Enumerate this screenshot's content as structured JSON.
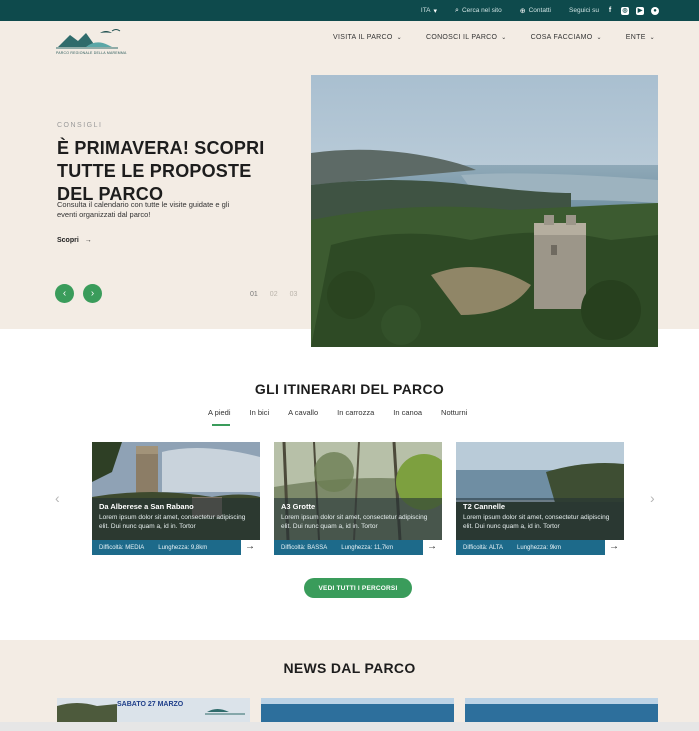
{
  "topbar": {
    "language": "ITA",
    "search": "Cerca nel sito",
    "contacts": "Contatti",
    "follow": "Seguici su",
    "socials": [
      "facebook-icon",
      "instagram-icon",
      "youtube-icon",
      "tripadvisor-icon"
    ]
  },
  "header": {
    "logo_text": "PARCO REGIONALE DELLA MAREMMA",
    "nav": [
      "VISITA IL PARCO",
      "CONOSCI IL PARCO",
      "COSA FACCIAMO",
      "ENTE"
    ]
  },
  "hero": {
    "kicker": "CONSIGLI",
    "title": "È PRIMAVERA! SCOPRI TUTTE LE PROPOSTE DEL PARCO",
    "description": "Consulta il calendario con tutte le visite guidate e gli eventi organizzati dal parco!",
    "cta": "Scopri",
    "dots": [
      "01",
      "02",
      "03"
    ]
  },
  "itinerari": {
    "title": "GLI ITINERARI DEL PARCO",
    "tabs": [
      "A piedi",
      "In bici",
      "A cavallo",
      "In carrozza",
      "In canoa",
      "Notturni"
    ],
    "cards": [
      {
        "title": "Da Alberese a San Rabano",
        "text": "Lorem ipsum dolor sit amet, consectetur adipiscing elit. Dui nunc quam a, id in. Tortor",
        "difficulty": "Difficoltà: MEDIA",
        "length": "Lunghezza: 9,8km"
      },
      {
        "title": "A3 Grotte",
        "text": "Lorem ipsum dolor sit amet, consectetur adipiscing elit. Dui nunc quam a, id in. Tortor",
        "difficulty": "Difficoltà: BASSA",
        "length": "Lunghezza: 11,7km"
      },
      {
        "title": "T2 Cannelle",
        "text": "Lorem ipsum dolor sit amet, consectetur adipiscing elit. Dui nunc quam a, id in. Tortor",
        "difficulty": "Difficoltà: ALTA",
        "length": "Lunghezza: 9km"
      }
    ],
    "cta": "VEDI TUTTI I PERCORSI"
  },
  "news": {
    "title": "NEWS DAL PARCO",
    "first_date": "SABATO 27 MARZO"
  },
  "colors": {
    "topbar": "#0e4a4c",
    "cream": "#f3ece4",
    "green": "#3a9c5b",
    "card_footer": "#1d6a8a"
  }
}
